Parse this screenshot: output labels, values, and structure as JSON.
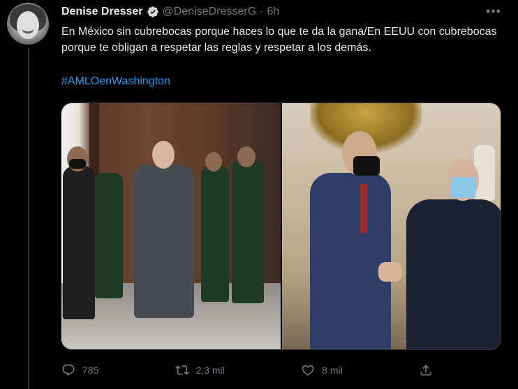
{
  "author": {
    "name": "Denise Dresser",
    "handle": "@DeniseDresserG",
    "separator": "·",
    "time": "6h",
    "verified": true,
    "verified_color": "#d9d9d9"
  },
  "tweet": {
    "text": "En México sin cubrebocas porque haces lo que te da la gana/En EEUU con cubrebocas porque te obligan a respetar las reglas y respetar a los demás.",
    "hashtag": "#AMLOenWashington"
  },
  "actions": {
    "reply_count": "785",
    "retweet_count": "2,3 mil",
    "like_count": "8 mil"
  },
  "icons": {
    "more": "more-dots-icon",
    "reply": "comment-icon",
    "retweet": "retweet-icon",
    "like": "heart-icon",
    "share": "share-icon"
  },
  "colors": {
    "background": "#000000",
    "text": "#e7e9ea",
    "muted": "#71767b",
    "link": "#1d9bf0"
  }
}
